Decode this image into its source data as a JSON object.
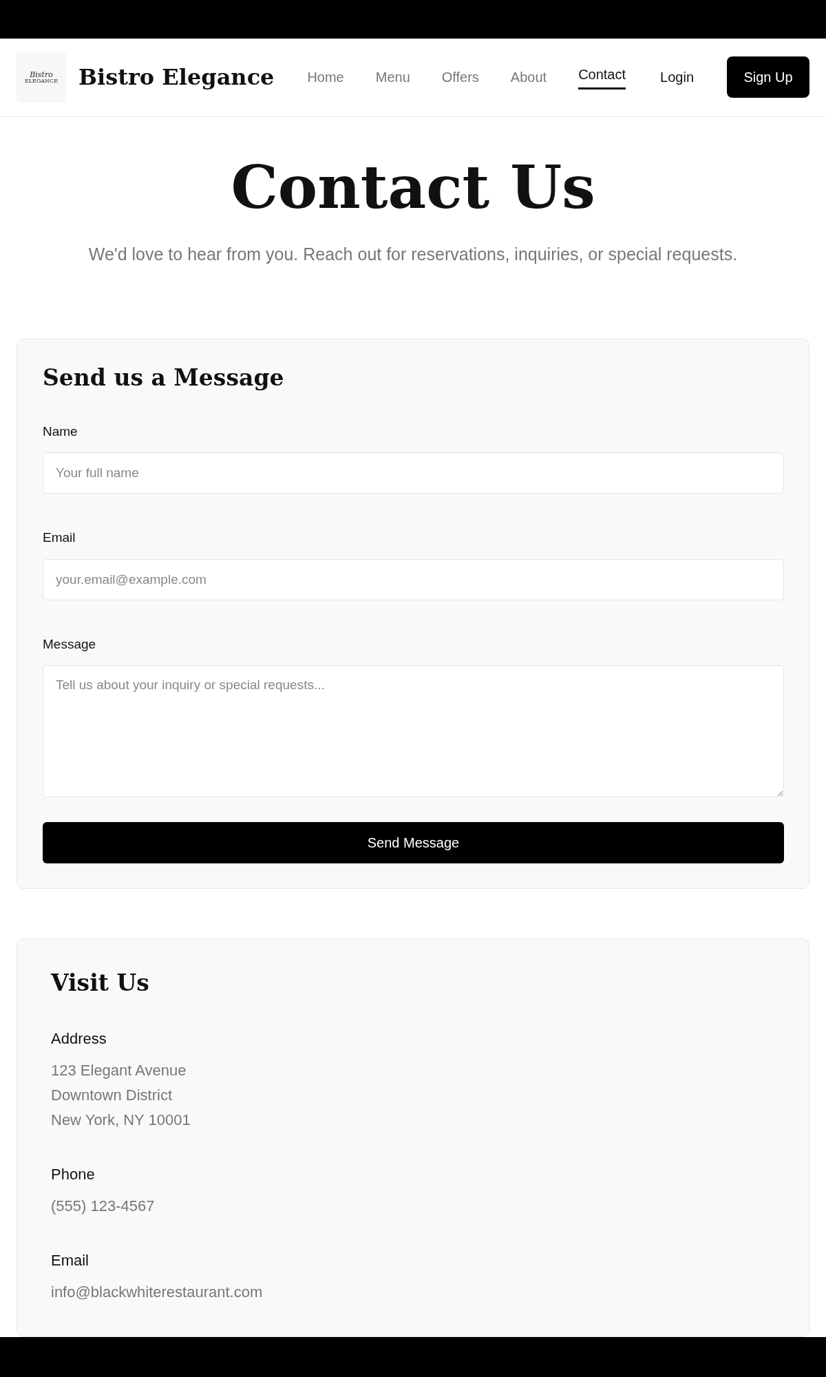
{
  "logo": {
    "lines": [
      "Bistro",
      "ELEGANCE"
    ]
  },
  "brand": "Bistro Elegance",
  "nav": [
    {
      "label": "Home",
      "selected": false
    },
    {
      "label": "Menu",
      "selected": false
    },
    {
      "label": "Offers",
      "selected": false
    },
    {
      "label": "About",
      "selected": false
    },
    {
      "label": "Contact",
      "selected": true
    }
  ],
  "login": "Login",
  "signup": "Sign Up",
  "hero": {
    "title": "Contact Us",
    "subtitle": "We'd love to hear from you. Reach out for reservations, inquiries, or special requests."
  },
  "form": {
    "title": "Send us a Message",
    "fields": [
      {
        "kind": "input",
        "label": "Name",
        "placeholder": "Your full name"
      },
      {
        "kind": "input",
        "label": "Email",
        "placeholder": "your.email@example.com"
      },
      {
        "kind": "textarea",
        "label": "Message",
        "placeholder": "Tell us about your inquiry or special requests..."
      }
    ],
    "submit": "Send Message"
  },
  "visit": {
    "title": "Visit Us",
    "sections": [
      {
        "label": "Address",
        "lines": [
          "123 Elegant Avenue",
          "Downtown District",
          "New York, NY 10001"
        ]
      },
      {
        "label": "Phone",
        "lines": [
          "(555) 123-4567"
        ]
      },
      {
        "label": "Email",
        "lines": [
          "info@blackwhiterestaurant.com"
        ]
      }
    ]
  }
}
